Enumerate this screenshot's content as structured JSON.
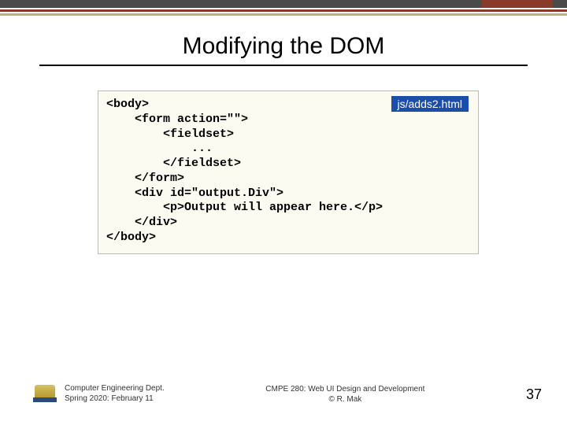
{
  "slide": {
    "title": "Modifying the DOM",
    "file_label": "js/adds2.html",
    "code": "<body>\n    <form action=\"\">\n        <fieldset>\n            ...\n        </fieldset>\n    </form>\n    <div id=\"output.Div\">\n        <p>Output will appear here.</p>\n    </div>\n</body>"
  },
  "footer": {
    "dept": "Computer Engineering Dept.",
    "term": "Spring 2020: February 11",
    "course": "CMPE 280: Web UI Design and Development",
    "author": "© R. Mak",
    "page": "37"
  }
}
